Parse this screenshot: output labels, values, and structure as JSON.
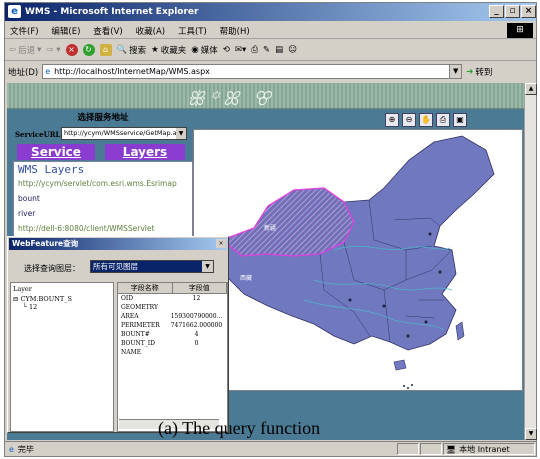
{
  "window": {
    "title": "WMS - Microsoft Internet Explorer",
    "min": "_",
    "max": "▫",
    "close": "×"
  },
  "menu": [
    "文件(F)",
    "编辑(E)",
    "查看(V)",
    "收藏(A)",
    "工具(T)",
    "帮助(H)"
  ],
  "toolbar": {
    "back": "后退",
    "search": "搜索",
    "favorites": "收藏夹",
    "media": "媒体"
  },
  "address": {
    "label": "地址(D)",
    "url": "http://localhost/InternetMap/WMS.aspx",
    "go": "转到"
  },
  "service": {
    "title": "选择服务地址",
    "url_label": "ServiceURL",
    "url_value": "http://ycym/WMSservice/GetMap.a",
    "tab_service": "Service",
    "tab_layers": "Layers"
  },
  "layers": {
    "heading": "WMS Layers",
    "items": [
      {
        "text": "http://ycym/servlet/com.esri.wms.Esrimap",
        "kind": "url"
      },
      {
        "text": "bount",
        "kind": "layer"
      },
      {
        "text": "river",
        "kind": "layer"
      },
      {
        "text": "http://dell-6:8080/client/WMSServlet",
        "kind": "url"
      }
    ]
  },
  "map_tools": [
    "zoom-in",
    "zoom-out",
    "pan",
    "print",
    "identify"
  ],
  "map_labels": [
    "新疆",
    "西藏"
  ],
  "dialog": {
    "title": "WebFeature查询",
    "close": "×",
    "select_label": "选择查询图层：",
    "select_value": "所有可见图层",
    "tree_root": "Layer",
    "tree_node": "CYM.BOUNT_S",
    "tree_leaf": "12",
    "col_name": "字段名称",
    "col_value": "字段值",
    "rows": [
      {
        "name": "OID",
        "value": "12"
      },
      {
        "name": "GEOMETRY",
        "value": ""
      },
      {
        "name": "AREA",
        "value": "159300790000..."
      },
      {
        "name": "PERIMETER",
        "value": "7471662.000000"
      },
      {
        "name": "BOUNT#",
        "value": "4"
      },
      {
        "name": "BOUNT_ID",
        "value": "0"
      },
      {
        "name": "NAME",
        "value": ""
      }
    ]
  },
  "caption": "(a) The query function",
  "status": {
    "text": "完毕",
    "zone": "本地 Intranet"
  }
}
